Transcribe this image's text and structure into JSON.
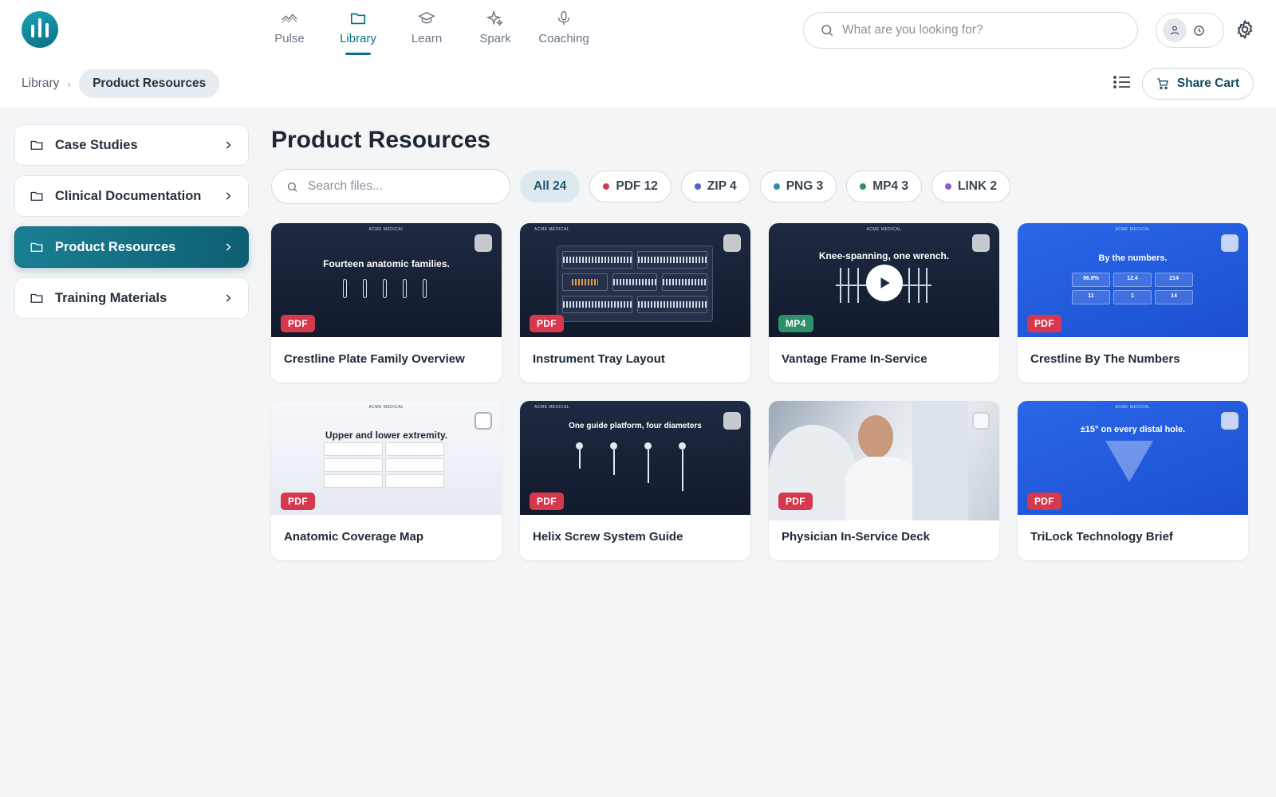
{
  "nav": {
    "items": [
      {
        "label": "Pulse",
        "icon": "pulse-icon"
      },
      {
        "label": "Library",
        "icon": "folder-icon",
        "active": true
      },
      {
        "label": "Learn",
        "icon": "graduation-cap-icon"
      },
      {
        "label": "Spark",
        "icon": "sparkle-icon"
      },
      {
        "label": "Coaching",
        "icon": "microphone-icon"
      }
    ]
  },
  "search": {
    "placeholder": "What are you looking for?"
  },
  "breadcrumb": {
    "root": "Library",
    "current": "Product Resources"
  },
  "share_cart": {
    "label": "Share Cart"
  },
  "sidebar": {
    "items": [
      {
        "label": "Case Studies"
      },
      {
        "label": "Clinical Documentation"
      },
      {
        "label": "Product Resources",
        "active": true
      },
      {
        "label": "Training Materials"
      }
    ]
  },
  "main": {
    "title": "Product Resources",
    "file_search": {
      "placeholder": "Search files..."
    },
    "filters": [
      {
        "label": "All 24",
        "active": true,
        "color": null
      },
      {
        "label": "PDF 12",
        "color": "#d6384e"
      },
      {
        "label": "ZIP 4",
        "color": "#4a63d8"
      },
      {
        "label": "PNG 3",
        "color": "#2f8fa8"
      },
      {
        "label": "MP4 3",
        "color": "#2f8f6b"
      },
      {
        "label": "LINK 2",
        "color": "#8b5cd6"
      }
    ],
    "cards": [
      {
        "title": "Crestline Plate Family Overview",
        "type": "PDF",
        "thumb_text": "Fourteen anatomic families."
      },
      {
        "title": "Instrument Tray Layout",
        "type": "PDF",
        "thumb_text": ""
      },
      {
        "title": "Vantage Frame In-Service",
        "type": "MP4",
        "thumb_text": "Knee-spanning, one wrench."
      },
      {
        "title": "Crestline By The Numbers",
        "type": "PDF",
        "thumb_text": "By the numbers.",
        "stats": [
          "96.8%",
          "12.4",
          "214",
          "11",
          "1",
          "14"
        ]
      },
      {
        "title": "Anatomic Coverage Map",
        "type": "PDF",
        "thumb_text": "Upper and lower extremity."
      },
      {
        "title": "Helix Screw System Guide",
        "type": "PDF",
        "thumb_text": "One guide platform, four diameters"
      },
      {
        "title": "Physician In-Service Deck",
        "type": "PDF",
        "thumb_text": ""
      },
      {
        "title": "TriLock Technology Brief",
        "type": "PDF",
        "thumb_text": "±15° on every distal hole."
      }
    ],
    "thumb_brand": "ACME MEDICAL"
  },
  "colors": {
    "accent": "#0e6f86",
    "pdf": "#d6384e",
    "mp4": "#2f8f6b"
  }
}
